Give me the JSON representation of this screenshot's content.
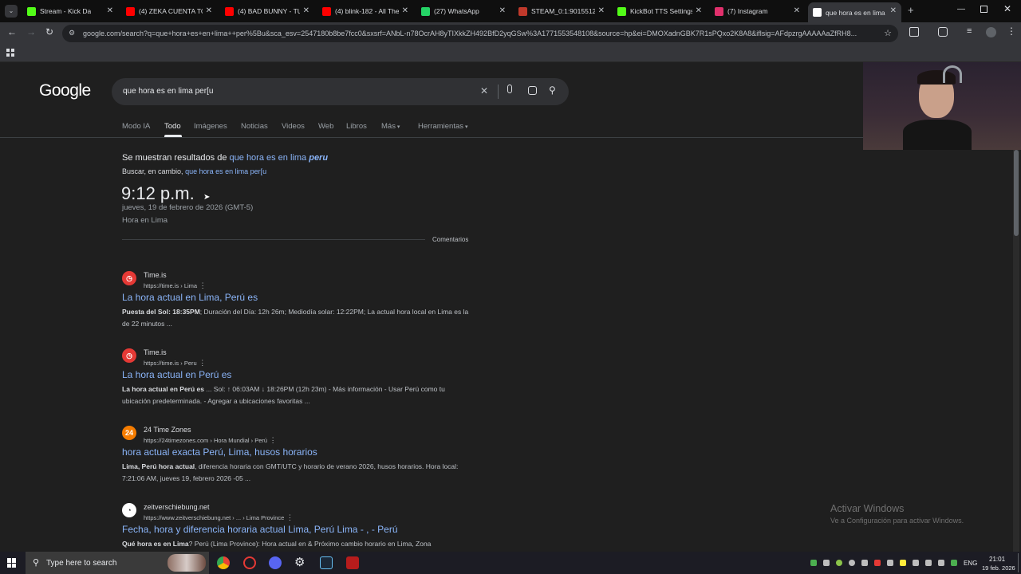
{
  "tabs": [
    {
      "title": "Stream - Kick Da",
      "color": "#53fc18"
    },
    {
      "title": "(4) ZEKA CUENTA TO",
      "color": "#ff0000"
    },
    {
      "title": "(4) BAD BUNNY - TU",
      "color": "#ff0000"
    },
    {
      "title": "(4) blink-182 - All The",
      "color": "#ff0000"
    },
    {
      "title": "(27) WhatsApp",
      "color": "#25d366"
    },
    {
      "title": "STEAM_0:1:9015512",
      "color": "#c0392b"
    },
    {
      "title": "KickBot TTS Settings",
      "color": "#53fc18"
    },
    {
      "title": "(7) Instagram",
      "color": "#e1306c"
    },
    {
      "title": "que hora es en lima",
      "color": "#ffffff"
    }
  ],
  "address_bar": {
    "url": "google.com/search?q=que+hora+es+en+lima++per%5Bu&sca_esv=2547180b8be7fcc0&sxsrf=ANbL-n78OcrAH8yTIXkkZH492BfD2yqGSw%3A1771553548108&source=hp&ei=DMOXadnGBK7R1sPQxo2K8A8&iflsig=AFdpzrgAAAAAaZfRH8..."
  },
  "google": {
    "logo": "Google",
    "query": "que hora es en lima per[u",
    "nav": [
      "Modo IA",
      "Todo",
      "Imágenes",
      "Noticias",
      "Videos",
      "Web",
      "Libros",
      "Más",
      "Herramientas"
    ],
    "active_nav": "Todo"
  },
  "correction": {
    "prefix": "Se muestran resultados de",
    "link_a": "que hora es en lima",
    "link_b": "peru",
    "instead_prefix": "Buscar, en cambio,",
    "instead_link": "que hora es en lima per[u"
  },
  "time_card": {
    "time": "9:12 p.m.",
    "date": "jueves, 19 de febrero de 2026 (GMT-5)",
    "place": "Hora en Lima",
    "feedback": "Comentarios"
  },
  "results": [
    {
      "icon": "timeis-icon",
      "icon_text": "◷",
      "icon_color": "#e53935",
      "site": "Time.is",
      "url": "https://time.is › Lima",
      "title": "La hora actual en Lima, Perú es",
      "snippet_bold": "Puesta del Sol: 18:35PM",
      "snippet": "; Duración del Día: 12h 26m; Mediodía solar: 12:22PM; La actual hora local en Lima es la de 22 minutos ..."
    },
    {
      "icon": "timeis-icon",
      "icon_text": "◷",
      "icon_color": "#e53935",
      "site": "Time.is",
      "url": "https://time.is › Peru",
      "title": "La hora actual en Perú es",
      "snippet_bold": "La hora actual en Perú es",
      "snippet": " ... Sol: ↑ 06:03AM ↓ 18:26PM (12h 23m) - Más información - Usar Perú como tu ubicación predeterminada. - Agregar a ubicaciones favoritas ..."
    },
    {
      "icon": "24timezones-icon",
      "icon_text": "24",
      "icon_color": "#f57c00",
      "site": "24 Time Zones",
      "url": "https://24timezones.com › Hora Mundial › Perú",
      "title": "hora actual exacta Perú, Lima, husos horarios",
      "snippet_bold": "Lima, Perú hora actual",
      "snippet": ", diferencia horaria con GMT/UTC y horario de verano 2026, husos horarios. Hora local: 7:21:06 AM, jueves 19, febrero 2026 -05 ..."
    },
    {
      "icon": "clock-icon",
      "icon_text": "◔",
      "icon_color": "#ffffff",
      "site": "zeitverschiebung.net",
      "url": "https://www.zeitverschiebung.net › ... › Lima Province",
      "title": "Fecha, hora y diferencia horaria actual Lima, Perú Lima - , - Perú",
      "snippet_bold": "Qué hora es en Lima",
      "snippet": "? Perú (Lima Province): Hora actual en & Próximo cambio horario en Lima, Zona"
    }
  ],
  "watermark": {
    "title": "Activar Windows",
    "subtitle": "Ve a Configuración para activar Windows."
  },
  "taskbar": {
    "search_placeholder": "Type here to search",
    "lang": "ENG",
    "time": "21:01",
    "date": "19 feb. 2026"
  }
}
